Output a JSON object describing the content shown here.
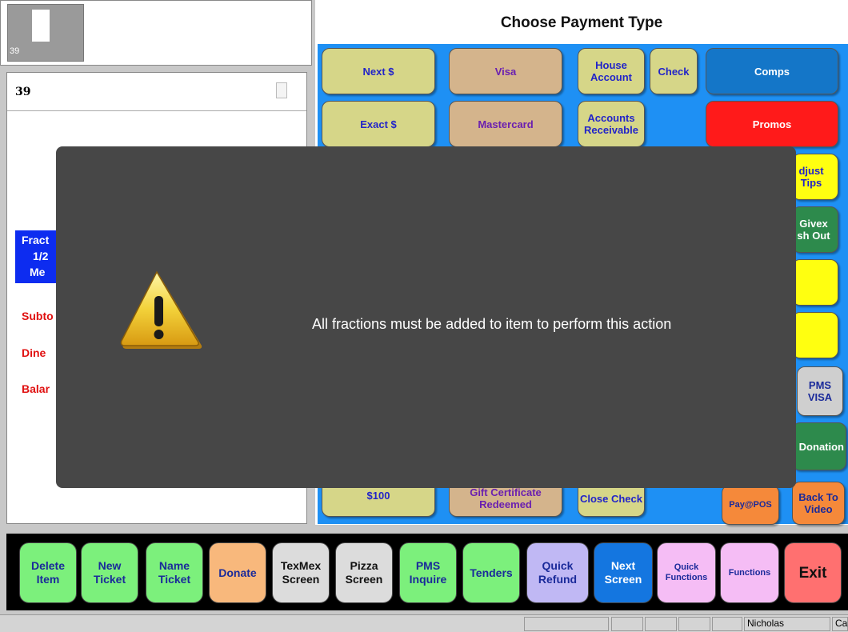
{
  "ticket": {
    "thumb_number": "39",
    "order_number": "39",
    "fraction_lines": [
      "Fract",
      "1/2",
      "Me"
    ],
    "subtotal_label": "Subto",
    "dine_label": "Dine",
    "balance_label": "Balar"
  },
  "payment": {
    "title": "Choose Payment Type",
    "buttons": {
      "next_dollar": "Next $",
      "visa": "Visa",
      "house_account": "House Account",
      "check": "Check",
      "comps": "Comps",
      "exact_dollar": "Exact $",
      "mastercard": "Mastercard",
      "accounts_receivable": "Accounts Receivable",
      "promos": "Promos",
      "adjust_tips": "djust Tips",
      "givex_cash_out": "Givex sh Out",
      "pms_visa": "PMS VISA",
      "donation": "Donation",
      "hundred": "$100",
      "gift_certificate": "Gift Certificate Redeemed",
      "close_check": "Close Check",
      "pay_at_pos": "Pay@POS",
      "back_to_video": "Back To Video"
    }
  },
  "bottom_bar": {
    "delete_item": "Delete Item",
    "new_ticket": "New Ticket",
    "name_ticket": "Name Ticket",
    "donate": "Donate",
    "texmex_screen": "TexMex Screen",
    "pizza_screen": "Pizza Screen",
    "pms_inquire": "PMS Inquire",
    "tenders": "Tenders",
    "quick_refund": "Quick Refund",
    "next_screen": "Next Screen",
    "quick_functions": "Quick Functions",
    "functions": "Functions",
    "exit": "Exit"
  },
  "status_bar": {
    "user": "Nicholas",
    "extra": "Ca"
  },
  "modal": {
    "icon": "warning-icon",
    "message": "All fractions must be added to item to perform this action"
  },
  "colors": {
    "payment_area": "#1e90f4",
    "modal_bg": "#474747",
    "promos": "#ff1a1a",
    "comps": "#1476c8"
  }
}
